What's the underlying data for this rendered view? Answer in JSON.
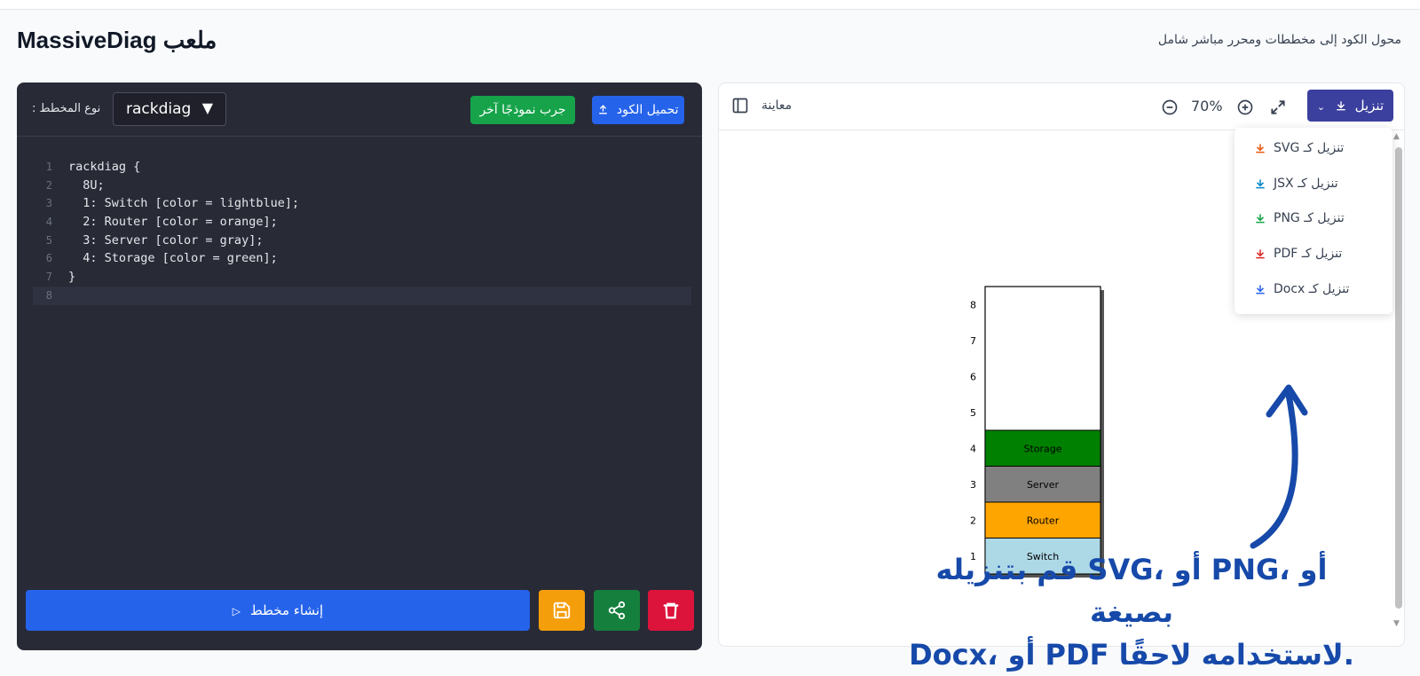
{
  "header": {
    "brand": "MassiveDiag ملعب",
    "tagline": "محول الكود إلى مخططات ومحرر مباشر شامل"
  },
  "editor": {
    "diagram_type_label": "نوع المخطط :",
    "diagram_type_value": "rackdiag",
    "try_sample_label": "جرب نموذجًا آخر",
    "upload_label": "تحميل الكود",
    "code_lines": [
      "rackdiag {",
      "  8U;",
      "  1: Switch [color = lightblue];",
      "  2: Router [color = orange];",
      "  3: Server [color = gray];",
      "  4: Storage [color = green];",
      "}",
      ""
    ],
    "generate_label": "إنشاء مخطط"
  },
  "preview": {
    "title": "معاينة",
    "zoom": "70%",
    "download_label": "تنزيل",
    "download_menu": [
      {
        "label": "SVG تنزيل كـ",
        "color": "#ea580c"
      },
      {
        "label": "JSX تنزيل كـ",
        "color": "#0284c7"
      },
      {
        "label": "PNG تنزيل كـ",
        "color": "#16a34a"
      },
      {
        "label": "PDF تنزيل كـ",
        "color": "#dc2626"
      },
      {
        "label": "Docx تنزيل كـ",
        "color": "#2563eb"
      }
    ],
    "rack": {
      "units": [
        "1",
        "2",
        "3",
        "4",
        "5",
        "6",
        "7",
        "8"
      ],
      "devices": [
        {
          "unit": 1,
          "label": "Switch",
          "color": "#add8e6"
        },
        {
          "unit": 2,
          "label": "Router",
          "color": "#ffa500"
        },
        {
          "unit": 3,
          "label": "Server",
          "color": "#808080"
        },
        {
          "unit": 4,
          "label": "Storage",
          "color": "#008000"
        }
      ]
    }
  },
  "annotation": {
    "line1": "أو ،PNG أو ،SVG قم بتنزيله بصيغة",
    "line2": ".لاستخدامه لاحقًا PDF أو ،Docx"
  }
}
